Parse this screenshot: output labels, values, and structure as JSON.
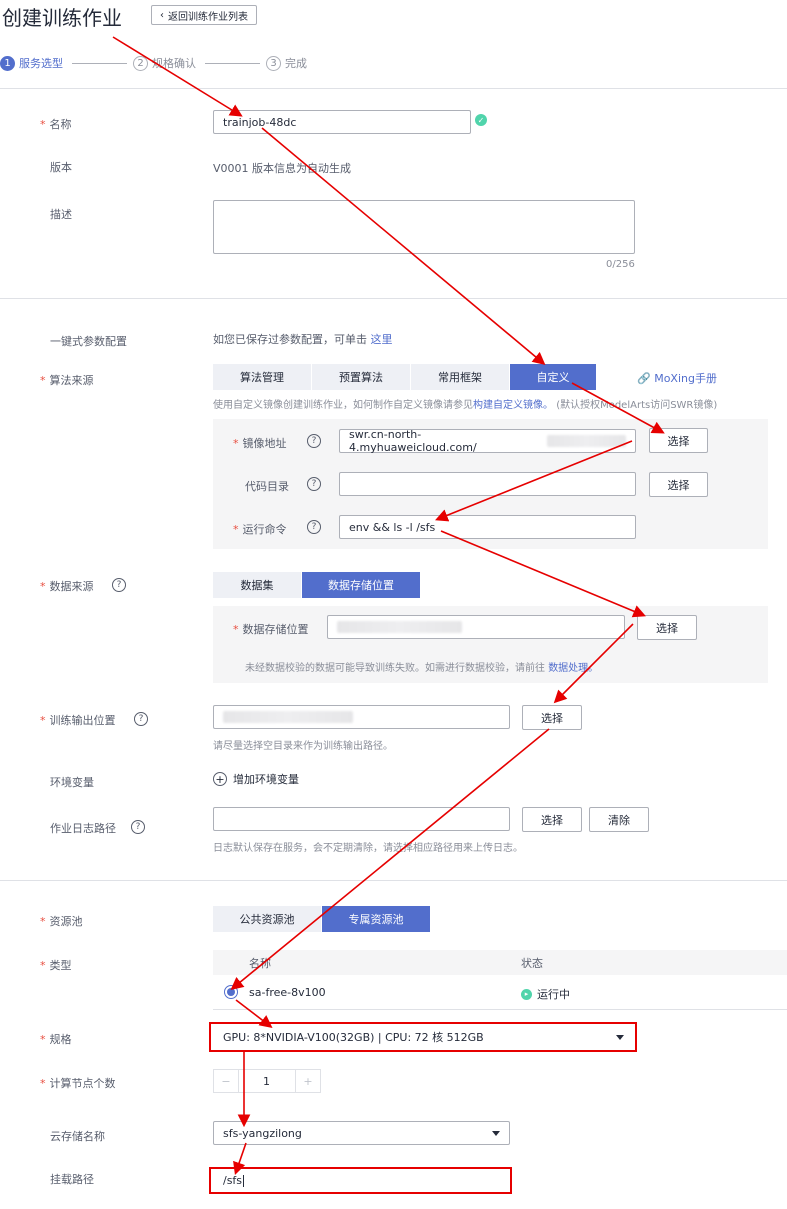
{
  "header": {
    "title": "创建训练作业",
    "back_label": "返回训练作业列表"
  },
  "steps": [
    {
      "num": "1",
      "label": "服务选型"
    },
    {
      "num": "2",
      "label": "规格确认"
    },
    {
      "num": "3",
      "label": "完成"
    }
  ],
  "form": {
    "name_label": "名称",
    "name_value": "trainjob-48dc",
    "version_label": "版本",
    "version_value": "V0001 版本信息为自动生成",
    "desc_label": "描述",
    "desc_counter": "0/256",
    "oneclick_label": "一键式参数配置",
    "oneclick_text": "如您已保存过参数配置，可单击",
    "oneclick_link": "这里",
    "algo_label": "算法来源",
    "algo_tabs": [
      "算法管理",
      "预置算法",
      "常用框架",
      "自定义"
    ],
    "moxing_link": "MoXing手册",
    "algo_hint": "使用自定义镜像创建训练作业，如何制作自定义镜像请参见",
    "algo_hint_link": "构建自定义镜像。",
    "algo_hint_tail": "(默认授权ModelArts访问SWR镜像)",
    "image_label": "镜像地址",
    "image_value": "swr.cn-north-4.myhuaweicloud.com/",
    "code_label": "代码目录",
    "cmd_label": "运行命令",
    "cmd_value": "env && ls -l /sfs",
    "select_label": "选择",
    "clear_label": "清除",
    "data_label": "数据来源",
    "data_tabs": [
      "数据集",
      "数据存储位置"
    ],
    "data_loc_label": "数据存储位置",
    "data_hint": "未经数据校验的数据可能导致训练失败。如需进行数据校验，请前往",
    "data_hint_link": "数据处理。",
    "output_label": "训练输出位置",
    "output_hint": "请尽量选择空目录来作为训练输出路径。",
    "env_label": "环境变量",
    "env_add": "增加环境变量",
    "log_label": "作业日志路径",
    "log_hint": "日志默认保存在服务，会不定期清除，请选择相应路径用来上传日志。",
    "pool_label": "资源池",
    "pool_tabs": [
      "公共资源池",
      "专属资源池"
    ],
    "type_label": "类型",
    "type_table": {
      "col_name": "名称",
      "col_status": "状态",
      "row_name": "sa-free-8v100",
      "row_status": "运行中"
    },
    "spec_label": "规格",
    "spec_value": "GPU: 8*NVIDIA-V100(32GB) | CPU: 72 核 512GB",
    "nodes_label": "计算节点个数",
    "nodes_value": "1",
    "storage_label": "云存储名称",
    "storage_value": "sfs-yangzilong",
    "mount_label": "挂载路径",
    "mount_value": "/sfs"
  },
  "colors": {
    "accent": "#526ecc",
    "annotation": "#e60000",
    "success": "#50d4ab"
  }
}
